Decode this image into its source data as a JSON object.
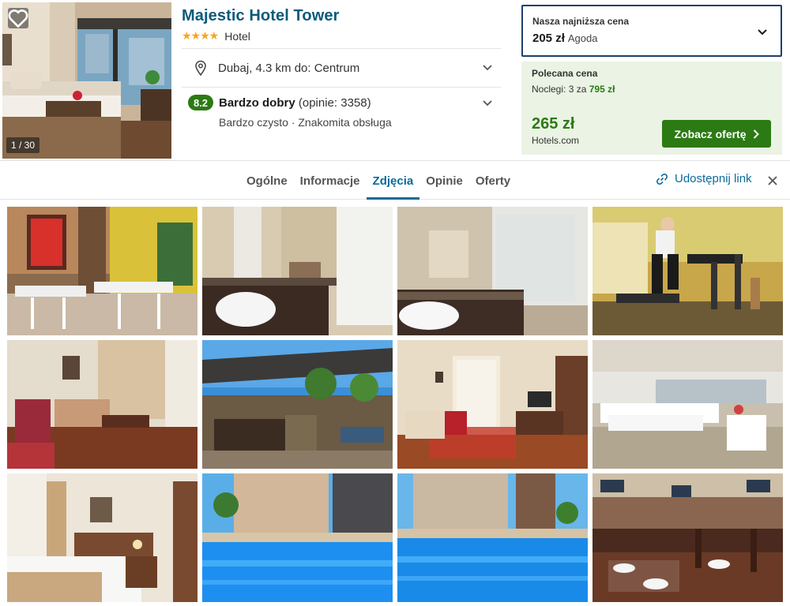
{
  "hotel": {
    "name": "Majestic Hotel Tower",
    "stars": "★★★★",
    "type": "Hotel",
    "photo_counter": "1 / 30",
    "location": "Dubaj, 4.3 km do: Centrum",
    "rating_score": "8.2",
    "rating_label": "Bardzo dobry",
    "rating_reviews": "(opinie: 3358)",
    "rating_highlights": "Bardzo czysto · Znakomita obsługa"
  },
  "lowest_price": {
    "label": "Nasza najniższa cena",
    "amount": "205 zł",
    "provider": "Agoda"
  },
  "recommended_price": {
    "label": "Polecana cena",
    "nights_prefix": "Noclegi: 3 za",
    "nights_total": "795 zł",
    "amount": "265 zł",
    "provider": "Hotels.com",
    "cta": "Zobacz ofertę"
  },
  "tabs": [
    {
      "label": "Ogólne"
    },
    {
      "label": "Informacje"
    },
    {
      "label": "Zdjęcia"
    },
    {
      "label": "Opinie"
    },
    {
      "label": "Oferty"
    }
  ],
  "active_tab": "Zdjęcia",
  "share_label": "Udostępnij link",
  "colors": {
    "brand_blue": "#0b5a7a",
    "tab_active": "#0b6b9a",
    "deal_green": "#2c7a14",
    "price_box_border": "#1d3f6e",
    "recommended_bg": "#eaf3e4",
    "star": "#f5a623"
  },
  "icons": [
    "heart-icon",
    "map-pin-icon",
    "chevron-down-icon",
    "link-icon",
    "close-icon",
    "chevron-right-icon"
  ]
}
